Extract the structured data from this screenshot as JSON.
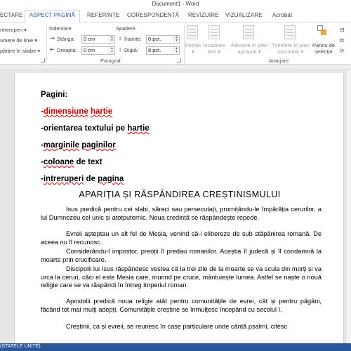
{
  "window": {
    "title": "Document1 - Word"
  },
  "tabs": [
    "ECTARE",
    "ASPECT PAGINĂ",
    "REFERINȚE",
    "CORESPONDENȚĂ",
    "REVIZUIRE",
    "VIZUALIZARE",
    "Acrobat"
  ],
  "ribbon": {
    "page_setup": {
      "breaks": "ntreruperi",
      "line_numbers": "umere de linie",
      "hyphenation": "părțire în silabe"
    },
    "paragraph": {
      "indent_header": "Indentare",
      "spacing_header": "Spațiere",
      "left_label": "Stânga:",
      "left_value": "0 cm",
      "right_label": "Dreapta:",
      "right_value": "0 cm",
      "before_label": "Înainte:",
      "before_value": "0 pct.",
      "after_label": "După:",
      "after_value": "8 pct.",
      "group_label": "Paragraf"
    },
    "arrange": {
      "position": "Poziție",
      "wrap_text_1": "Încadrare",
      "wrap_text_2": "text",
      "bring_forward_1": "Aducere în plan",
      "bring_forward_2": "apropiat",
      "send_backward_1": "Trimitere în plan",
      "send_backward_2": "secundar",
      "selection_pane_1": "Panou de",
      "selection_pane_2": "selecție",
      "group_label": "Aranjare"
    }
  },
  "document": {
    "list_title": "Pagini:",
    "list_items": [
      "-dimensiune hartie",
      "-orientarea textului pe hartie",
      "-marginile paginilor",
      "-coloane de text",
      "-intreruperi de pagina"
    ],
    "heading": "APARIȚIA ȘI RĂSPÂNDIREA CREȘTINISMULUI",
    "paragraphs": [
      "Isus predică pentru cei slabi, săraci sau persecutați, promițându-le împărăția cerurilor, a lui Dumnezeu cel unic și atotputernic. Noua credință se răspândește repede.",
      "Evreii așteptau un alt fel de Mesia, venind să-i elibereze de sub stăpânirea romană. De aceea nu îl recunosc.",
      "Considerându-l impostor, preoții îl predau romanilor. Aceștia îl judecă și îl condamnă la moarte prin crucificare.",
      "Discipolii lui Isus răspândesc vestea că la trei zile de la moarte se va scula din morți și va urca la ceruri, căci el este Mesia care, murind pe cruce, mântuiește lumea. Astfel se naște o nouă religie care se va răspândi în întreg Imperiul roman.",
      "Apostolii predică noua religie atât pentru comunitățile de evrei, cât și pentru păgâni, făcând tot mai mulți adepți. Comunitățile creștine se înmulțesc începând cu secolul I.",
      "Creștinii, ca și evreii, se reunesc în case particulare unde cântă psalmi, citesc"
    ]
  },
  "status": {
    "language": "(STATELE UNITE)"
  },
  "colors": {
    "accent": "#2b579a",
    "error_underline": "#dd0000",
    "red_text": "#c00000"
  }
}
